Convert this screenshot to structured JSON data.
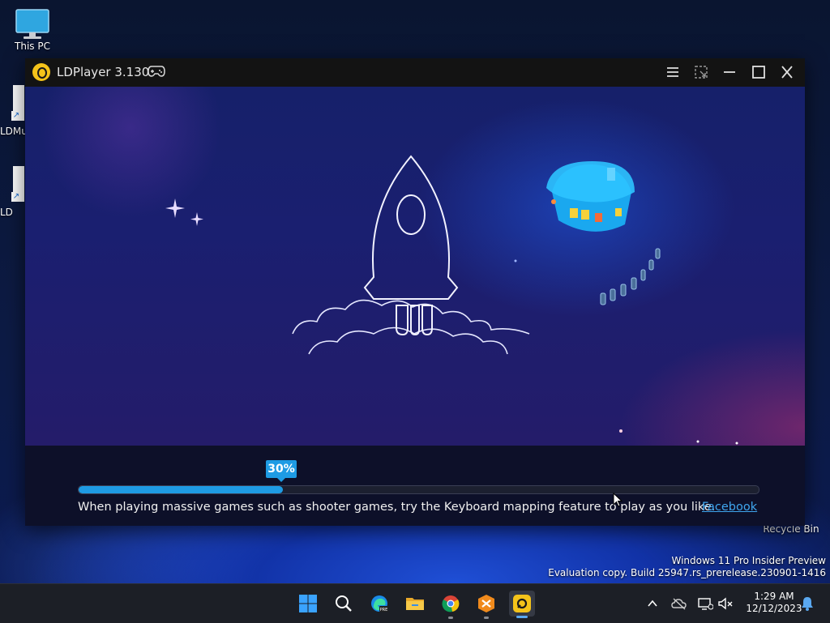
{
  "desktop": {
    "icons": [
      {
        "label": "This PC"
      },
      {
        "label": "LDMu"
      },
      {
        "label": "LD"
      }
    ],
    "recycle_bin": "Recycle Bin",
    "watermark_line1": "Windows 11 Pro Insider Preview",
    "watermark_line2": "Evaluation copy. Build 25947.rs_prerelease.230901-1416"
  },
  "window": {
    "title": "LDPlayer 3.130",
    "accent_color": "#1e9be4",
    "logo_color": "#f4c31a"
  },
  "loading": {
    "progress_label": "30%",
    "progress_value": 0.3,
    "tip": "When playing massive games such as shooter games, try the Keyboard mapping feature to play as you like.",
    "link": "Facebook"
  },
  "taskbar": {
    "apps": [
      "start-icon",
      "search-icon",
      "edge-icon",
      "file-explorer-icon",
      "chrome-icon",
      "toolbox-icon",
      "ldplayer-icon"
    ],
    "clock_time": "1:29 AM",
    "clock_date": "12/12/2023"
  }
}
